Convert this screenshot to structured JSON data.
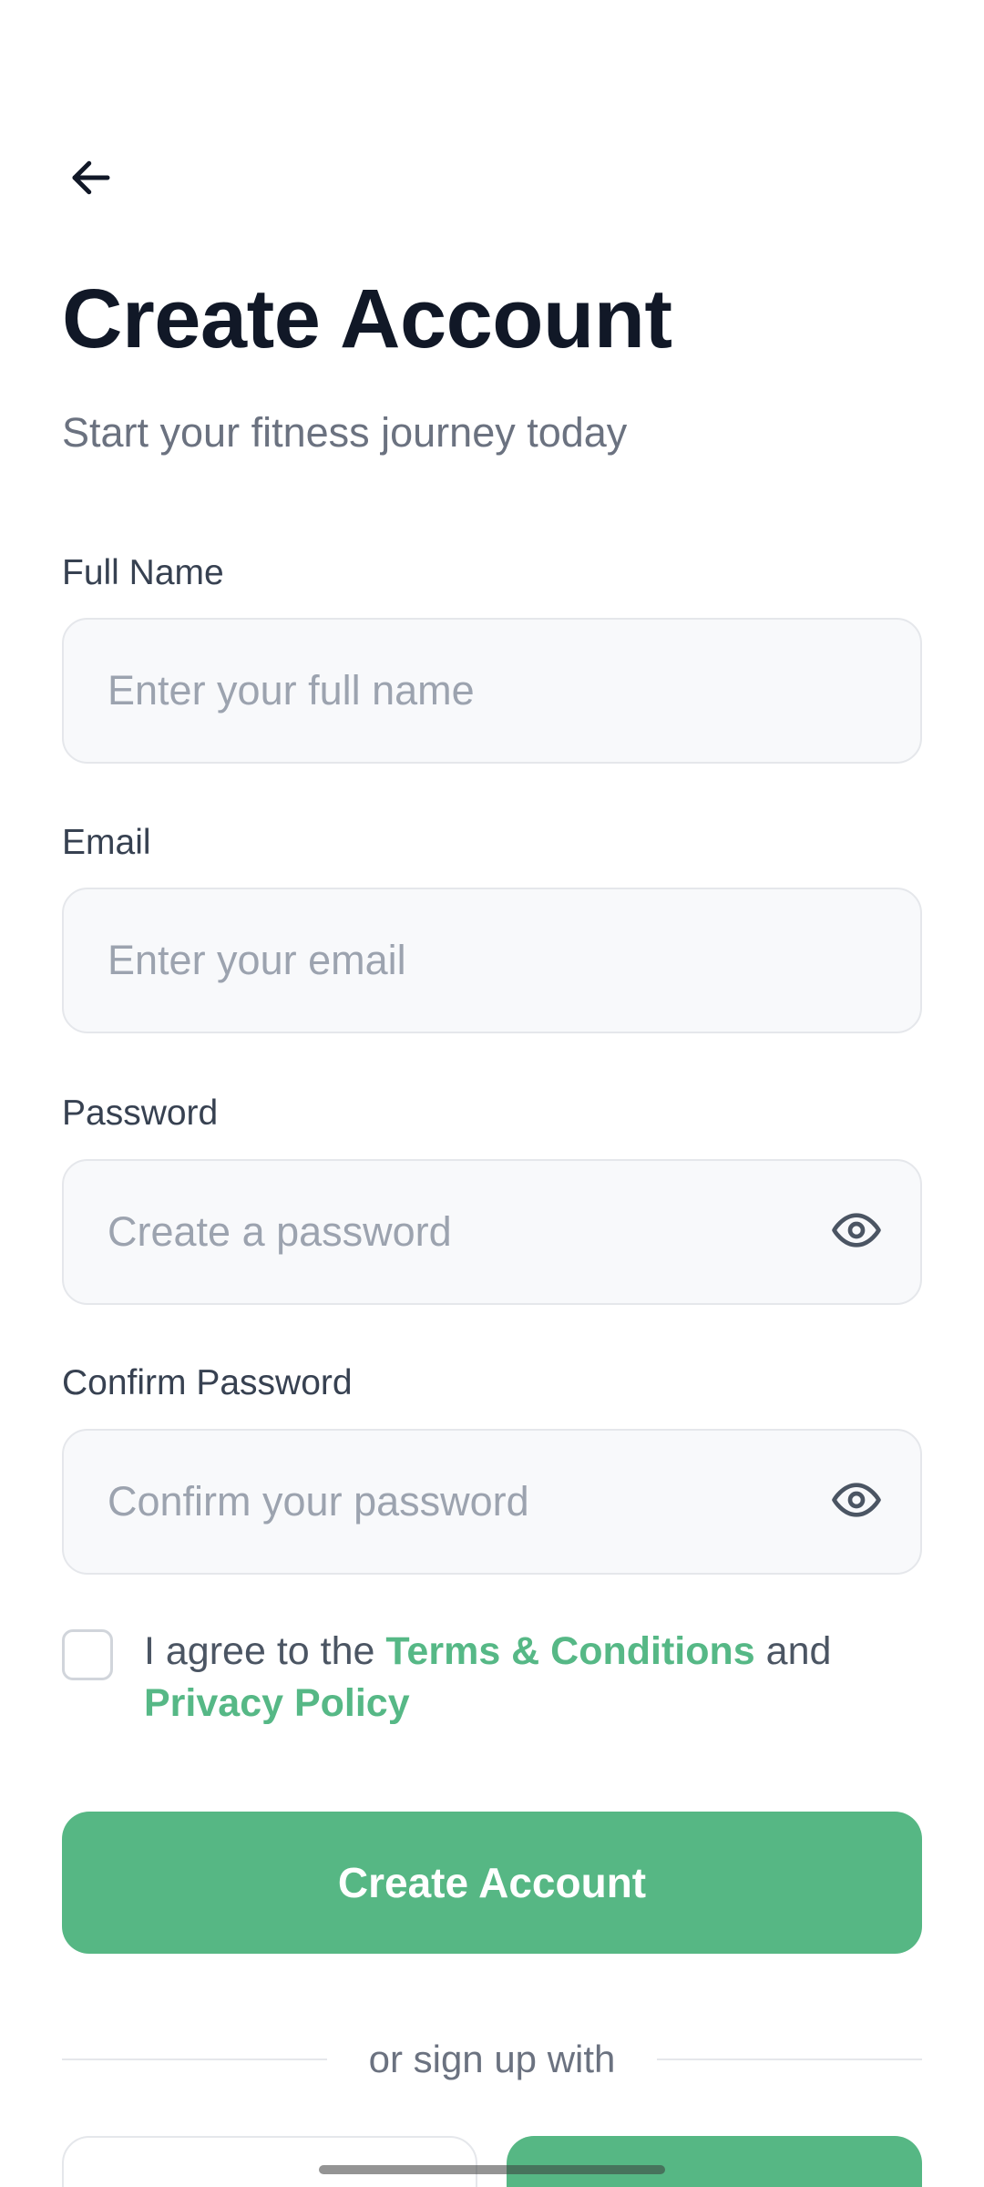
{
  "header": {
    "back_icon": "arrow-left-icon",
    "title": "Create Account",
    "subtitle": "Start your fitness journey today"
  },
  "form": {
    "full_name": {
      "label": "Full Name",
      "placeholder": "Enter your full name",
      "value": ""
    },
    "email": {
      "label": "Email",
      "placeholder": "Enter your email",
      "value": ""
    },
    "password": {
      "label": "Password",
      "placeholder": "Create a password",
      "value": "",
      "toggle_icon": "eye-icon"
    },
    "confirm_password": {
      "label": "Confirm Password",
      "placeholder": "Confirm your password",
      "value": "",
      "toggle_icon": "eye-icon"
    }
  },
  "agreement": {
    "checked": false,
    "prefix": "I agree to the ",
    "terms_link": "Terms & Conditions",
    "middle": " and",
    "privacy_link": "Privacy Policy"
  },
  "actions": {
    "submit_label": "Create Account",
    "divider_text": "or sign up with"
  },
  "colors": {
    "accent": "#56b784",
    "title": "#111827",
    "muted": "#6b7280",
    "field_bg": "#f8f9fb",
    "field_border": "#e5e7eb"
  }
}
